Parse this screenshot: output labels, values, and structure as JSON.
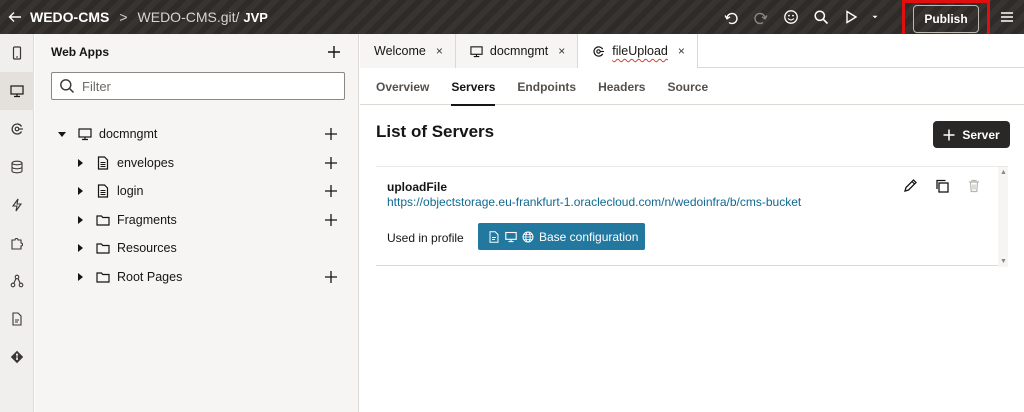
{
  "header": {
    "back_icon": "arrow-left-icon",
    "app_name": "WEDO-CMS",
    "separator": ">",
    "repo": "WEDO-CMS.git/",
    "branch": "JVP",
    "actions": [
      "undo-icon",
      "redo-icon",
      "smiley-icon",
      "search-icon",
      "play-icon",
      "caret-down-icon"
    ],
    "publish_label": "Publish",
    "menu_icon": "hamburger-menu-icon",
    "highlight_color": "#e01010"
  },
  "rail": {
    "items": [
      "mobile-icon",
      "desktop-icon",
      "service-icon",
      "database-icon",
      "lightning-icon",
      "puzzle-icon",
      "hierarchy-icon",
      "document-icon",
      "git-icon"
    ],
    "active_index": 1
  },
  "sidebar": {
    "title": "Web Apps",
    "filter_placeholder": "Filter",
    "tree": [
      {
        "label": "docmngmt",
        "icon": "desktop-icon",
        "level": 0,
        "expanded": true,
        "has_add": true
      },
      {
        "label": "envelopes",
        "icon": "page-icon",
        "level": 1,
        "expanded": false,
        "has_add": true
      },
      {
        "label": "login",
        "icon": "page-icon",
        "level": 1,
        "expanded": false,
        "has_add": true
      },
      {
        "label": "Fragments",
        "icon": "folder-icon",
        "level": 1,
        "expanded": false,
        "has_add": true
      },
      {
        "label": "Resources",
        "icon": "folder-icon",
        "level": 1,
        "expanded": false,
        "has_add": false
      },
      {
        "label": "Root Pages",
        "icon": "folder-icon",
        "level": 1,
        "expanded": false,
        "has_add": true
      }
    ]
  },
  "main": {
    "tabs": [
      {
        "label": "Welcome",
        "icon": "",
        "close": "×"
      },
      {
        "label": "docmngmt",
        "icon": "desktop-icon",
        "close": "×"
      },
      {
        "label": "fileUpload",
        "icon": "service-icon",
        "close": "×",
        "active": true
      }
    ],
    "subtabs": [
      "Overview",
      "Servers",
      "Endpoints",
      "Headers",
      "Source"
    ],
    "active_subtab": "Servers",
    "list_title": "List of Servers",
    "add_server_label": "Server",
    "servers": [
      {
        "name": "uploadFile",
        "url": "https://objectstorage.eu-frankfurt-1.oraclecloud.com/n/wedoinfra/b/cms-bucket",
        "used_in_profile_label": "Used in profile",
        "profile_label": "Base configuration"
      }
    ],
    "accent_color": "#22789f"
  }
}
